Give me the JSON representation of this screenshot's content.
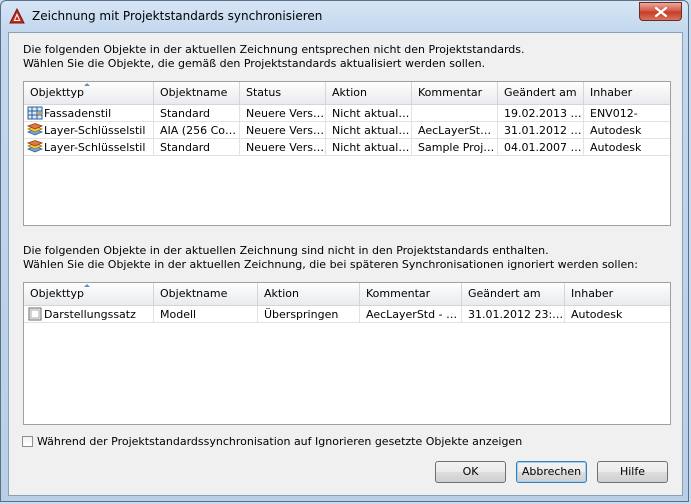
{
  "window": {
    "title": "Zeichnung mit Projektstandards synchronisieren"
  },
  "section1": {
    "line1": "Die folgenden Objekte in der aktuellen Zeichnung entsprechen nicht den Projektstandards.",
    "line2": "Wählen Sie die Objekte, die gemäß den Projektstandards aktualisiert werden sollen.",
    "columns": [
      "Objekttyp",
      "Objektname",
      "Status",
      "Aktion",
      "Kommentar",
      "Geändert am",
      "Inhaber"
    ],
    "rows": [
      {
        "icon": "facade-style-icon",
        "cells": [
          "Fassadenstil",
          "Standard",
          "Neuere Version",
          "Nicht aktuali…",
          "",
          "19.02.2013 …",
          "ENV012-"
        ]
      },
      {
        "icon": "layer-key-style-icon",
        "cells": [
          "Layer-Schlüsselstil",
          "AIA (256 Col…",
          "Neuere Version",
          "Nicht aktuali…",
          "AecLayerStd…",
          "31.01.2012 …",
          "Autodesk"
        ]
      },
      {
        "icon": "layer-key-style-icon",
        "cells": [
          "Layer-Schlüsselstil",
          "Standard",
          "Neuere Version",
          "Nicht aktuali…",
          "Sample Proje…",
          "04.01.2007 …",
          "Autodesk"
        ]
      }
    ]
  },
  "section2": {
    "line1": "Die folgenden Objekte in der aktuellen Zeichnung sind nicht in den Projektstandards enthalten.",
    "line2": "Wählen Sie die Objekte in der aktuellen Zeichnung, die bei späteren Synchronisationen ignoriert werden sollen:",
    "columns": [
      "Objekttyp",
      "Objektname",
      "Aktion",
      "Kommentar",
      "Geändert am",
      "Inhaber"
    ],
    "rows": [
      {
        "icon": "display-set-icon",
        "cells": [
          "Darstellungssatz",
          "Modell",
          "Überspringen",
          "AecLayerStd - 2…",
          "31.01.2012 23:…",
          "Autodesk"
        ]
      }
    ]
  },
  "options": {
    "show_ignored_label": "Während der Projektstandardssynchronisation auf Ignorieren gesetzte Objekte anzeigen",
    "show_ignored_checked": false
  },
  "buttons": {
    "ok": "OK",
    "cancel": "Abbrechen",
    "help": "Hilfe"
  },
  "colors": {
    "accent": "#3c7fb1",
    "close": "#c43b26"
  }
}
